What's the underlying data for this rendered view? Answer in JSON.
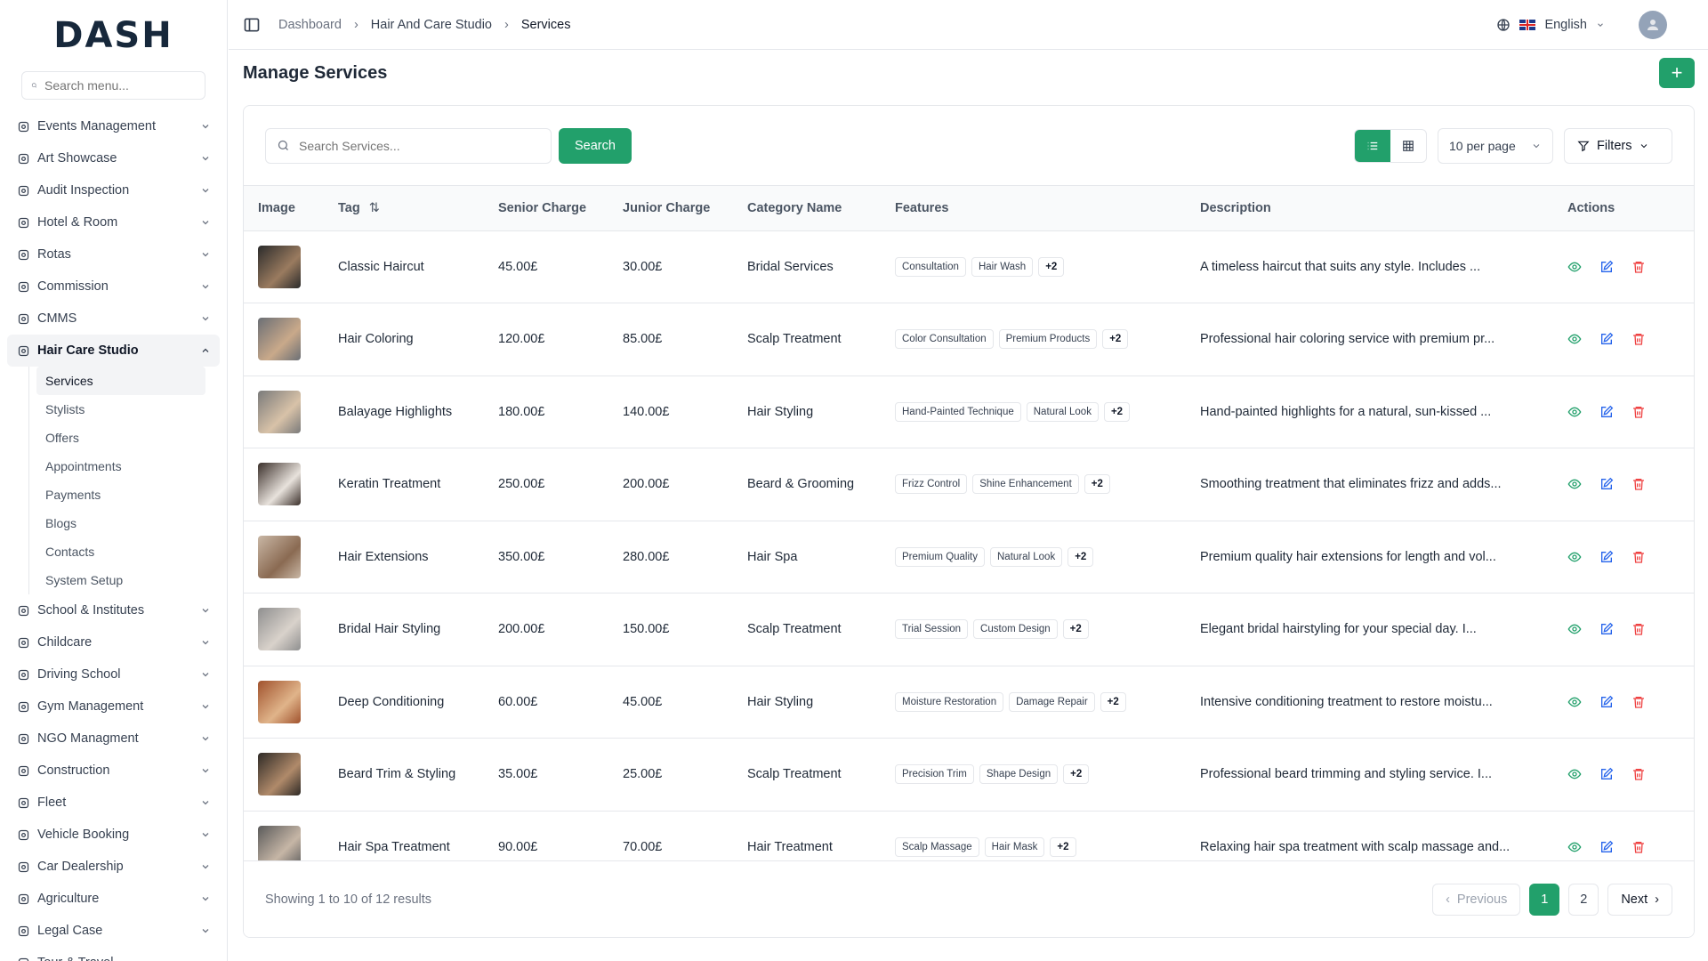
{
  "brand": {
    "logo": "DASH",
    "accent": "#22a06b"
  },
  "sidebar": {
    "search_placeholder": "Search menu...",
    "items_top": [
      {
        "label": "Events Management",
        "icon": "party-icon"
      },
      {
        "label": "Art Showcase",
        "icon": "palette-icon"
      },
      {
        "label": "Audit Inspection",
        "icon": "search-check-icon"
      },
      {
        "label": "Hotel & Room",
        "icon": "hotel-icon"
      },
      {
        "label": "Rotas",
        "icon": "calendar-icon"
      },
      {
        "label": "Commission",
        "icon": "trend-icon"
      },
      {
        "label": "CMMS",
        "icon": "gear-icon"
      }
    ],
    "active_group": {
      "label": "Hair Care Studio",
      "icon": "sparkles-icon"
    },
    "sub_items": [
      {
        "label": "Services"
      },
      {
        "label": "Stylists"
      },
      {
        "label": "Offers"
      },
      {
        "label": "Appointments"
      },
      {
        "label": "Payments"
      },
      {
        "label": "Blogs"
      },
      {
        "label": "Contacts"
      },
      {
        "label": "System Setup"
      }
    ],
    "items_bottom": [
      {
        "label": "School & Institutes",
        "icon": "school-icon"
      },
      {
        "label": "Childcare",
        "icon": "baby-icon"
      },
      {
        "label": "Driving School",
        "icon": "steering-icon"
      },
      {
        "label": "Gym Management",
        "icon": "dumbbell-icon"
      },
      {
        "label": "NGO Managment",
        "icon": "handshake-icon"
      },
      {
        "label": "Construction",
        "icon": "crane-icon"
      },
      {
        "label": "Fleet",
        "icon": "truck-icon"
      },
      {
        "label": "Vehicle Booking",
        "icon": "bus-icon"
      },
      {
        "label": "Car Dealership",
        "icon": "car-icon"
      },
      {
        "label": "Agriculture",
        "icon": "tractor-icon"
      },
      {
        "label": "Legal Case",
        "icon": "scale-icon"
      },
      {
        "label": "Tour & Travel",
        "icon": "plane-icon"
      }
    ]
  },
  "topbar": {
    "breadcrumb": [
      "Dashboard",
      "Hair And Care Studio",
      "Services"
    ],
    "language": "English"
  },
  "page": {
    "title": "Manage Services",
    "search_placeholder": "Search Services...",
    "search_label": "Search",
    "per_page": "10 per page",
    "filters_label": "Filters"
  },
  "table": {
    "columns": [
      "Image",
      "Tag",
      "Senior Charge",
      "Junior Charge",
      "Category Name",
      "Features",
      "Description",
      "Actions"
    ],
    "rows": [
      {
        "tag": "Classic Haircut",
        "senior": "45.00£",
        "junior": "30.00£",
        "category": "Bridal Services",
        "features": [
          "Consultation",
          "Hair Wash"
        ],
        "more": "+2",
        "description": "A timeless haircut that suits any style. Includes ...",
        "img": [
          "#2b2b2b",
          "#9a7b5f"
        ]
      },
      {
        "tag": "Hair Coloring",
        "senior": "120.00£",
        "junior": "85.00£",
        "category": "Scalp Treatment",
        "features": [
          "Color Consultation",
          "Premium Products"
        ],
        "more": "+2",
        "description": "Professional hair coloring service with premium pr...",
        "img": [
          "#6b6f75",
          "#c9a98a"
        ]
      },
      {
        "tag": "Balayage Highlights",
        "senior": "180.00£",
        "junior": "140.00£",
        "category": "Hair Styling",
        "features": [
          "Hand-Painted Technique",
          "Natural Look"
        ],
        "more": "+2",
        "description": "Hand-painted highlights for a natural, sun-kissed ...",
        "img": [
          "#7a7a7a",
          "#d8c2a8"
        ]
      },
      {
        "tag": "Keratin Treatment",
        "senior": "250.00£",
        "junior": "200.00£",
        "category": "Beard & Grooming",
        "features": [
          "Frizz Control",
          "Shine Enhancement"
        ],
        "more": "+2",
        "description": "Smoothing treatment that eliminates frizz and adds...",
        "img": [
          "#3a2f2a",
          "#e8e2dc"
        ]
      },
      {
        "tag": "Hair Extensions",
        "senior": "350.00£",
        "junior": "280.00£",
        "category": "Hair Spa",
        "features": [
          "Premium Quality",
          "Natural Look"
        ],
        "more": "+2",
        "description": "Premium quality hair extensions for length and vol...",
        "img": [
          "#c9b7a5",
          "#8a6a52"
        ]
      },
      {
        "tag": "Bridal Hair Styling",
        "senior": "200.00£",
        "junior": "150.00£",
        "category": "Scalp Treatment",
        "features": [
          "Trial Session",
          "Custom Design"
        ],
        "more": "+2",
        "description": "Elegant bridal hairstyling for your special day. I...",
        "img": [
          "#8f8f8f",
          "#d9d2cb"
        ]
      },
      {
        "tag": "Deep Conditioning",
        "senior": "60.00£",
        "junior": "45.00£",
        "category": "Hair Styling",
        "features": [
          "Moisture Restoration",
          "Damage Repair"
        ],
        "more": "+2",
        "description": "Intensive conditioning treatment to restore moistu...",
        "img": [
          "#a0522d",
          "#e0b48a"
        ]
      },
      {
        "tag": "Beard Trim & Styling",
        "senior": "35.00£",
        "junior": "25.00£",
        "category": "Scalp Treatment",
        "features": [
          "Precision Trim",
          "Shape Design"
        ],
        "more": "+2",
        "description": "Professional beard trimming and styling service. I...",
        "img": [
          "#2e2a26",
          "#b08a6a"
        ]
      },
      {
        "tag": "Hair Spa Treatment",
        "senior": "90.00£",
        "junior": "70.00£",
        "category": "Hair Treatment",
        "features": [
          "Scalp Massage",
          "Hair Mask"
        ],
        "more": "+2",
        "description": "Relaxing hair spa treatment with scalp massage and...",
        "img": [
          "#5a5a5a",
          "#c6b6a6"
        ]
      }
    ]
  },
  "pagination": {
    "showing": "Showing 1 to 10 of 12 results",
    "previous": "Previous",
    "pages": [
      "1",
      "2"
    ],
    "next": "Next"
  }
}
